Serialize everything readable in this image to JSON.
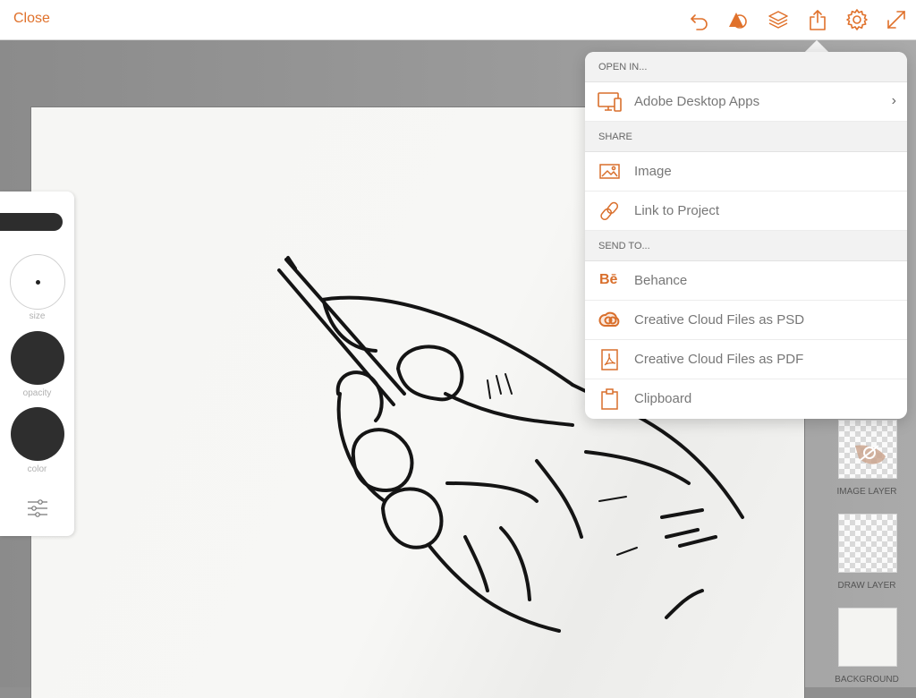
{
  "topbar": {
    "close_label": "Close",
    "icons": [
      "undo-icon",
      "shape-icon",
      "layers-icon",
      "share-icon",
      "settings-icon",
      "expand-icon"
    ]
  },
  "colors": {
    "accent": "#e0712b",
    "brush": "#2e2e2e"
  },
  "brush_panel": {
    "size_label": "size",
    "opacity_label": "opacity",
    "color_label": "color"
  },
  "layers": [
    {
      "label": "IMAGE LAYER"
    },
    {
      "label": "DRAW LAYER"
    },
    {
      "label": "BACKGROUND"
    }
  ],
  "share_menu": {
    "open_in_header": "OPEN IN...",
    "open_in": [
      {
        "label": "Adobe Desktop Apps",
        "icon": "desktop-devices-icon"
      }
    ],
    "share_header": "SHARE",
    "share": [
      {
        "label": "Image",
        "icon": "image-icon"
      },
      {
        "label": "Link to Project",
        "icon": "link-icon"
      }
    ],
    "send_to_header": "SEND TO...",
    "send_to": [
      {
        "label": "Behance",
        "icon": "behance-icon",
        "glyph": "Bē"
      },
      {
        "label": "Creative Cloud Files as PSD",
        "icon": "creative-cloud-icon"
      },
      {
        "label": "Creative Cloud Files as PDF",
        "icon": "pdf-icon"
      },
      {
        "label": "Clipboard",
        "icon": "clipboard-icon"
      }
    ]
  }
}
